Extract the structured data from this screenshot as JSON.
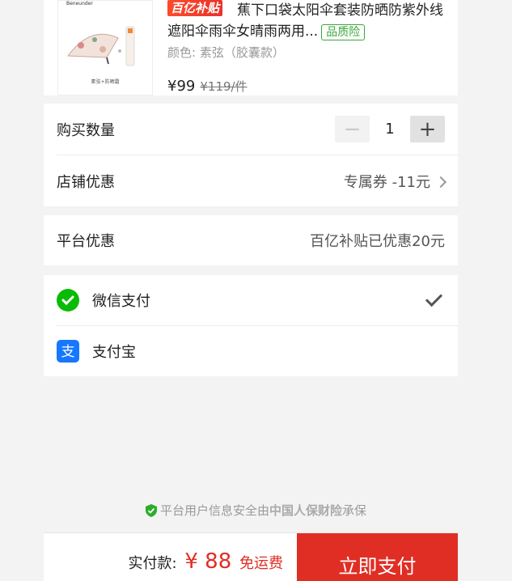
{
  "product": {
    "thumb_brand": "Beneunder",
    "thumb_caption": "素弦+防晒霜",
    "badge": "百亿补贴",
    "title": "蕉下口袋太阳伞套装防晒防紫外线遮阳伞雨伞女晴雨两用...",
    "quality_tag": "品质险",
    "variant": "颜色: 素弦（胶囊款）",
    "price": "¥99",
    "original_price": "¥119/件"
  },
  "quantity": {
    "label": "购买数量",
    "minus": "−",
    "value": "1",
    "plus": "+"
  },
  "store_discount": {
    "label": "店铺优惠",
    "value": "专属券 -11元"
  },
  "platform_discount": {
    "label": "平台优惠",
    "value": "百亿补贴已优惠20元"
  },
  "payment": {
    "wechat": {
      "label": "微信支付",
      "selected": true,
      "icon": "wechat-pay-icon",
      "color": "#09bb07"
    },
    "alipay": {
      "label": "支付宝",
      "selected": false,
      "icon": "alipay-icon",
      "color": "#1677ff"
    }
  },
  "security": {
    "prefix": "平台用户信息安全由",
    "insurer": "中国人保财险",
    "suffix": "承保"
  },
  "footer": {
    "total_label": "实付款:",
    "currency": "¥",
    "total": "88",
    "shipping": "免运费",
    "pay_button": "立即支付",
    "accent": "#e02e24"
  }
}
